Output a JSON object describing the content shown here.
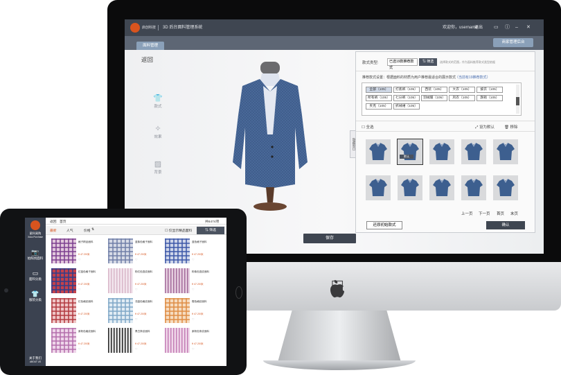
{
  "desktop": {
    "app_title": "3D 后台面料管理系统",
    "brand_name": "启创科技",
    "welcome": "欢迎你，username",
    "logout": "退出",
    "tab_fabric": "面料管理",
    "merchant_btn": "商家管理后台",
    "back": "返回",
    "side_items": [
      {
        "label": "款式",
        "icon": "shirt-icon"
      },
      {
        "label": "效果",
        "icon": "magic-icon"
      },
      {
        "label": "背景",
        "icon": "image-icon"
      }
    ],
    "style_type_label": "款式类型:",
    "style_type_value": "已选19款推荐款式",
    "filter_label": "筛选",
    "filter_hint": "选择款式的范围，作为面料推荐款式类型依据",
    "recommend_label": "推荐款式设置：根据面料的材质为用户推荐最适合的展示款式",
    "recommend_link": "（当前有19推荐款式）",
    "tags": [
      {
        "label": "全部（105）",
        "active": true
      },
      {
        "label": "打底裤（105）",
        "active": false
      },
      {
        "label": "西装（105）",
        "active": false
      },
      {
        "label": "大衣（105）",
        "active": false
      },
      {
        "label": "披衣（105）",
        "active": false
      },
      {
        "label": "所有裤（105）",
        "active": false
      },
      {
        "label": "七分裤（105）",
        "active": false
      },
      {
        "label": "羽绒服（105）",
        "active": false
      },
      {
        "label": "风衣（105）",
        "active": false
      },
      {
        "label": "旗袍（105）",
        "active": false
      },
      {
        "label": "夹克（105）",
        "active": false
      },
      {
        "label": "抓绒裙（105）",
        "active": false
      }
    ],
    "select_all": "全选",
    "set_default": "设为默认",
    "remove": "移除",
    "default_badge": "默认",
    "pagination": [
      "上一页",
      "下一页",
      "首页",
      "末页"
    ],
    "reset_btn": "还原初始款式",
    "confirm_btn": "确认",
    "save_btn": "保存",
    "side_tab": "隐藏窗口",
    "shirt_color": "#3d5f8f"
  },
  "tablet": {
    "brand_name": "星科易购",
    "brand_sub": "Xdoo Purchase",
    "side_items": [
      {
        "label": "拍照找面料",
        "icon": "camera-icon"
      },
      {
        "label": "面料分类",
        "icon": "folder-icon"
      },
      {
        "label": "服装分类",
        "icon": "tshirt-icon"
      }
    ],
    "about": "关于我们",
    "version": "ABOUT US",
    "breadcrumb_back": "返回",
    "breadcrumb_home": "首页",
    "count": "共6474项",
    "filters": [
      "最新",
      "人气",
      "价格"
    ],
    "filter_sort_icon": "⇅",
    "only_boutique": "仅显示精品面料",
    "filter_btn": "筛选",
    "fabrics": [
      {
        "name": "格子精品面料",
        "price": "¥ 47.20/米",
        "c1": "#7b3d8f",
        "c2": "#e2c8dc",
        "pattern": "plaid"
      },
      {
        "name": "蓝紫色格子面料",
        "price": "¥ 47.20/米",
        "c1": "#6f7da6",
        "c2": "#d6dae6",
        "pattern": "plaid"
      },
      {
        "name": "蓝色格子面料",
        "price": "¥ 47.20/米",
        "c1": "#3b55a6",
        "c2": "#cfd6ea",
        "pattern": "plaid"
      },
      {
        "name": "红蓝色格子面料",
        "price": "¥ 47.20/米",
        "c1": "#2d3f8c",
        "c2": "#c4414b",
        "pattern": "plaid"
      },
      {
        "name": "粉红色竖纹面料",
        "price": "¥ 47.20/米",
        "c1": "#d8b6c8",
        "c2": "#f3e6ee",
        "pattern": "stripe"
      },
      {
        "name": "粉紫色竖纹面料",
        "price": "¥ 47.20/米",
        "c1": "#a36a9a",
        "c2": "#e6cfe0",
        "pattern": "stripe"
      },
      {
        "name": "红色格纹面料",
        "price": "¥ 47.20/米",
        "c1": "#b1383e",
        "c2": "#efc6c6",
        "pattern": "plaid"
      },
      {
        "name": "浅蓝色格纹面料",
        "price": "¥ 47.20/米",
        "c1": "#7fa6c6",
        "c2": "#e1ecf4",
        "pattern": "plaid"
      },
      {
        "name": "橙色格纹面料",
        "price": "¥ 47.20/米",
        "c1": "#dd8c44",
        "c2": "#f6dcc0",
        "pattern": "plaid"
      },
      {
        "name": "紫粉色格纹面料",
        "price": "¥ 47.20/米",
        "c1": "#b26cab",
        "c2": "#efd6ea",
        "pattern": "plaid"
      },
      {
        "name": "黑白条纹面料",
        "price": "¥ 47.20/米",
        "c1": "#222222",
        "c2": "#e6e6e6",
        "pattern": "stripe"
      },
      {
        "name": "紫粉色条纹面料",
        "price": "¥ 47.20/米",
        "c1": "#c37db5",
        "c2": "#f0d8ea",
        "pattern": "stripe"
      }
    ]
  }
}
